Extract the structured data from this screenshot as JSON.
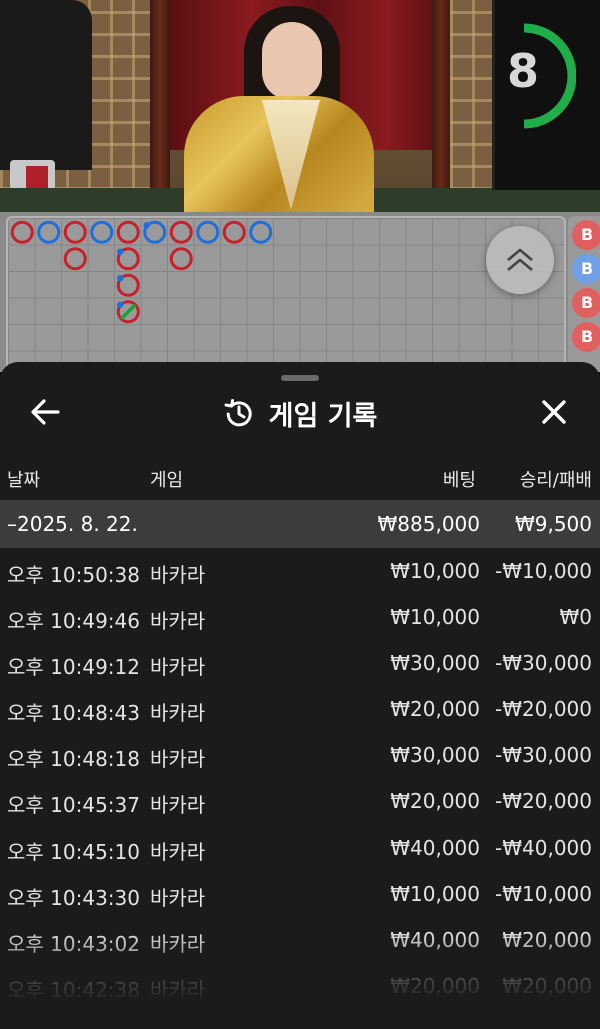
{
  "video": {
    "timer_value": "8",
    "timer_color": "#1fae4a"
  },
  "scoreboard": {
    "colors": {
      "banker": "#c8202a",
      "player": "#1e6fd9",
      "tie": "#17a23a"
    },
    "side_chips": [
      {
        "label": "B",
        "color": "#e06060"
      },
      {
        "label": "B",
        "color": "#6f9fe6"
      },
      {
        "label": "B",
        "color": "#e06060"
      },
      {
        "label": "B",
        "color": "#e06060"
      }
    ]
  },
  "panel": {
    "back_icon": "arrow-left-icon",
    "history_icon": "history-icon",
    "close_icon": "close-icon",
    "title": "게임 기록",
    "columns": {
      "date": "날짜",
      "game": "게임",
      "bet": "베팅",
      "winloss": "승리/패배"
    },
    "date_group": {
      "date": "–2025. 8. 22.",
      "bet_total": "₩885,000",
      "winloss_total": "₩9,500"
    },
    "rows": [
      {
        "time": "오후 10:50:38",
        "game": "바카라",
        "bet": "₩10,000",
        "winloss": "-₩10,000"
      },
      {
        "time": "오후 10:49:46",
        "game": "바카라",
        "bet": "₩10,000",
        "winloss": "₩0"
      },
      {
        "time": "오후 10:49:12",
        "game": "바카라",
        "bet": "₩30,000",
        "winloss": "-₩30,000"
      },
      {
        "time": "오후 10:48:43",
        "game": "바카라",
        "bet": "₩20,000",
        "winloss": "-₩20,000"
      },
      {
        "time": "오후 10:48:18",
        "game": "바카라",
        "bet": "₩30,000",
        "winloss": "-₩30,000"
      },
      {
        "time": "오후 10:45:37",
        "game": "바카라",
        "bet": "₩20,000",
        "winloss": "-₩20,000"
      },
      {
        "time": "오후 10:45:10",
        "game": "바카라",
        "bet": "₩40,000",
        "winloss": "-₩40,000"
      },
      {
        "time": "오후 10:43:30",
        "game": "바카라",
        "bet": "₩10,000",
        "winloss": "-₩10,000"
      },
      {
        "time": "오후 10:43:02",
        "game": "바카라",
        "bet": "₩40,000",
        "winloss": "₩20,000"
      },
      {
        "time": "오후 10:42:38",
        "game": "바카라",
        "bet": "₩20,000",
        "winloss": "₩20,000"
      }
    ]
  }
}
